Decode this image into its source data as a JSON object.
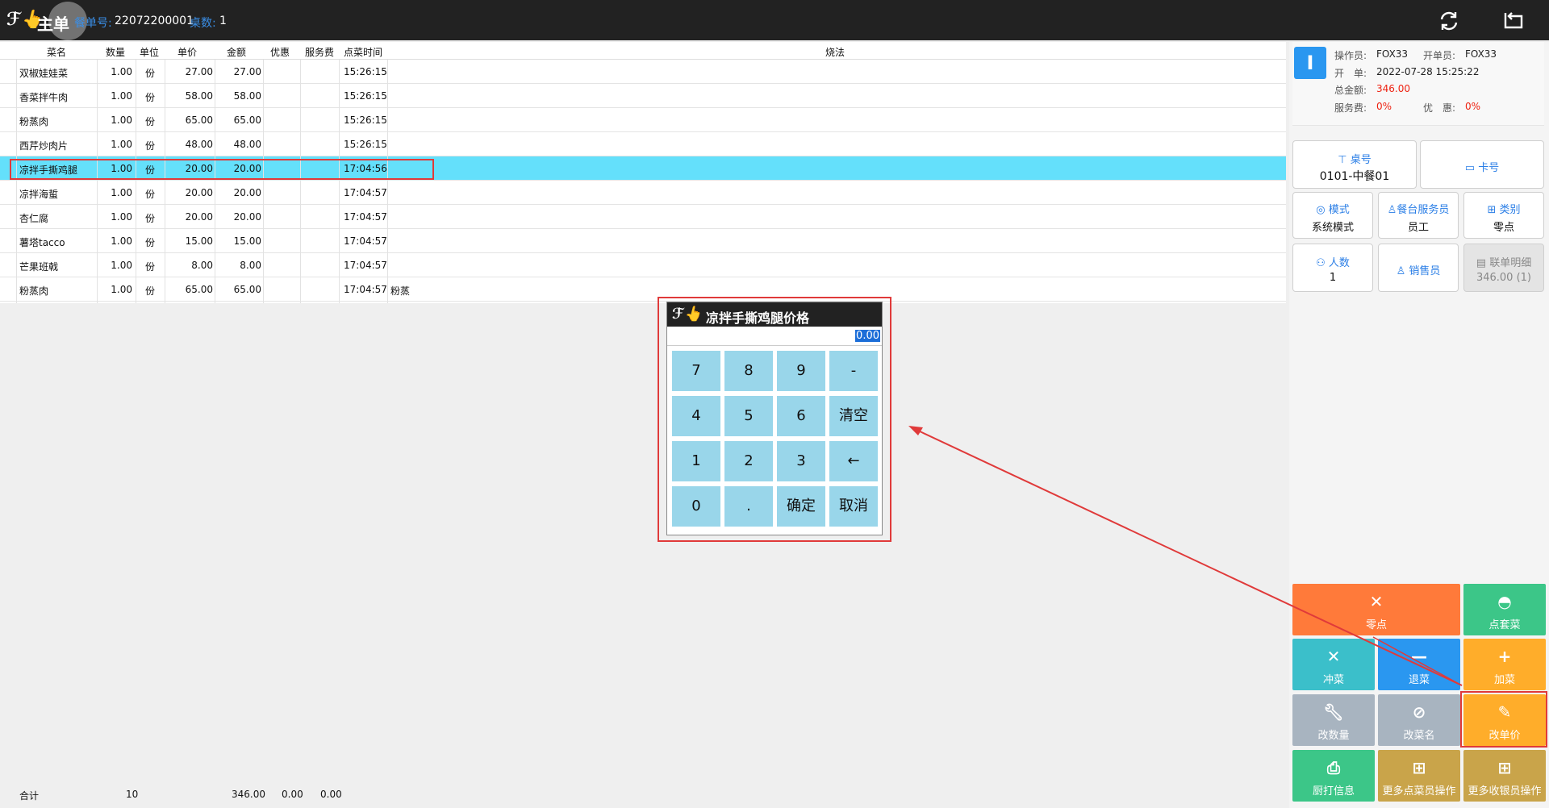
{
  "topbar": {
    "logo": "ℱ👆",
    "title": "主单",
    "order_label": "餐单号:",
    "order_no": "22072200001",
    "table_label": "桌数:",
    "table_count": "1"
  },
  "grid": {
    "headers": [
      "菜名",
      "数量",
      "单位",
      "单价",
      "金额",
      "优惠",
      "服务费",
      "点菜时间",
      "烧法"
    ],
    "rows": [
      {
        "name": "双椒娃娃菜",
        "qty": "1.00",
        "unit": "份",
        "price": "27.00",
        "amount": "27.00",
        "time": "15:26:15",
        "method": ""
      },
      {
        "name": "香菜拌牛肉",
        "qty": "1.00",
        "unit": "份",
        "price": "58.00",
        "amount": "58.00",
        "time": "15:26:15",
        "method": ""
      },
      {
        "name": "粉蒸肉",
        "qty": "1.00",
        "unit": "份",
        "price": "65.00",
        "amount": "65.00",
        "time": "15:26:15",
        "method": ""
      },
      {
        "name": "西芹炒肉片",
        "qty": "1.00",
        "unit": "份",
        "price": "48.00",
        "amount": "48.00",
        "time": "15:26:15",
        "method": ""
      },
      {
        "name": "凉拌手撕鸡腿",
        "qty": "1.00",
        "unit": "份",
        "price": "20.00",
        "amount": "20.00",
        "time": "17:04:56",
        "method": ""
      },
      {
        "name": "凉拌海蜇",
        "qty": "1.00",
        "unit": "份",
        "price": "20.00",
        "amount": "20.00",
        "time": "17:04:57",
        "method": ""
      },
      {
        "name": "杏仁腐",
        "qty": "1.00",
        "unit": "份",
        "price": "20.00",
        "amount": "20.00",
        "time": "17:04:57",
        "method": ""
      },
      {
        "name": "薯塔tacco",
        "qty": "1.00",
        "unit": "份",
        "price": "15.00",
        "amount": "15.00",
        "time": "17:04:57",
        "method": ""
      },
      {
        "name": "芒果班戟",
        "qty": "1.00",
        "unit": "份",
        "price": "8.00",
        "amount": "8.00",
        "time": "17:04:57",
        "method": ""
      },
      {
        "name": "粉蒸肉",
        "qty": "1.00",
        "unit": "份",
        "price": "65.00",
        "amount": "65.00",
        "time": "17:04:57",
        "method": "粉蒸"
      }
    ],
    "selected_row": 4
  },
  "totals": {
    "label": "合计",
    "qty": "10",
    "amount": "346.00",
    "discount": "0.00",
    "service": "0.00"
  },
  "info": {
    "badge": "I",
    "operator_label": "操作员:",
    "operator": "FOX33",
    "opener_label": "开单员:",
    "opener": "FOX33",
    "open_label": "开　单:",
    "open_time": "2022-07-28 15:25:22",
    "total_label": "总金额:",
    "total": "346.00",
    "service_label": "服务费:",
    "service": "0%",
    "discount_label": "优　惠:",
    "discount": "0%"
  },
  "tiles": {
    "table_no": {
      "label": "桌号",
      "value": "0101-中餐01"
    },
    "card_no": {
      "label": "卡号"
    },
    "mode": {
      "label": "模式",
      "value": "系统模式"
    },
    "waiter": {
      "label": "餐台服务员",
      "value": "员工"
    },
    "category": {
      "label": "类别",
      "value": "零点"
    },
    "guests": {
      "label": "人数",
      "value": "1"
    },
    "salesperson": {
      "label": "销售员"
    },
    "joint_detail": {
      "label": "联单明细",
      "value": "346.00 (1)"
    }
  },
  "actions": {
    "order_item": "零点",
    "order_set": "点套菜",
    "rush_dish": "冲菜",
    "return_dish": "退菜",
    "add_dish": "加菜",
    "change_qty": "改数量",
    "change_name": "改菜名",
    "change_price": "改单价",
    "kitchen_print": "厨打信息",
    "more_order_ops": "更多点菜员操作",
    "more_cashier_ops": "更多收银员操作"
  },
  "dialog": {
    "title": "凉拌手撕鸡腿价格",
    "value": "0.00",
    "keys": [
      "7",
      "8",
      "9",
      "-",
      "4",
      "5",
      "6",
      "清空",
      "1",
      "2",
      "3",
      "←",
      "0",
      ".",
      "确定",
      "取消"
    ]
  },
  "colors": {
    "accent": "#2a97f0",
    "selected_row": "#64e0fb",
    "orange": "#ff7a3a",
    "green": "#3cc688",
    "teal": "#3bbfca",
    "blue": "#2a97f0",
    "amber": "#ffad2a",
    "grey": "#a8b4c0",
    "gold": "#c9a44a",
    "key": "#99d6ea",
    "highlight": "#e03a3a"
  }
}
